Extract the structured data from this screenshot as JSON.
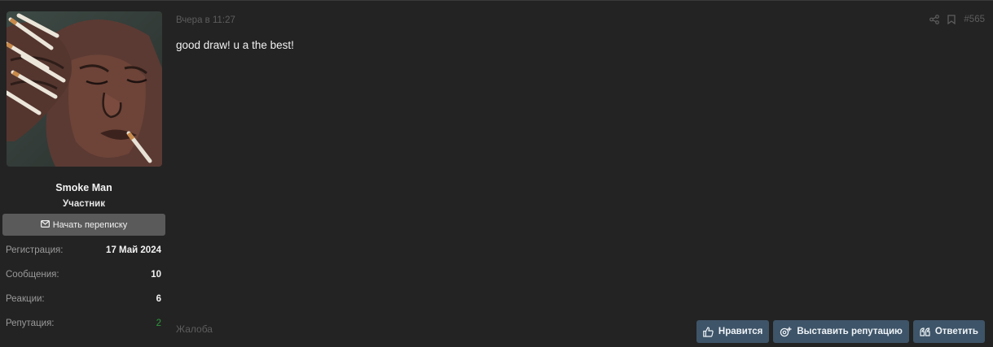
{
  "post": {
    "date": "Вчера в 11:27",
    "number": "#565",
    "message": "good draw! u a the best!",
    "report_label": "Жалоба"
  },
  "user": {
    "name": "Smoke Man",
    "title": "Участник",
    "start_conversation_label": "Начать переписку",
    "stats": [
      {
        "label": "Регистрация:",
        "value": "17 Май 2024"
      },
      {
        "label": "Сообщения:",
        "value": "10"
      },
      {
        "label": "Реакции:",
        "value": "6"
      },
      {
        "label": "Репутация:",
        "value": "2"
      }
    ]
  },
  "actions": {
    "like_label": "Нравится",
    "reputation_label": "Выставить репутацию",
    "reply_label": "Ответить"
  },
  "icons": {
    "share": "share-icon",
    "bookmark": "bookmark-icon",
    "envelope": "envelope-icon",
    "thumbs_up": "thumbs-up-icon",
    "reputation": "reputation-icon",
    "quote": "quote-icon"
  },
  "colors": {
    "background": "#232323",
    "button": "#3e5468",
    "reputation_positive": "#2e9a3c",
    "muted_text": "#5d5d5d"
  }
}
